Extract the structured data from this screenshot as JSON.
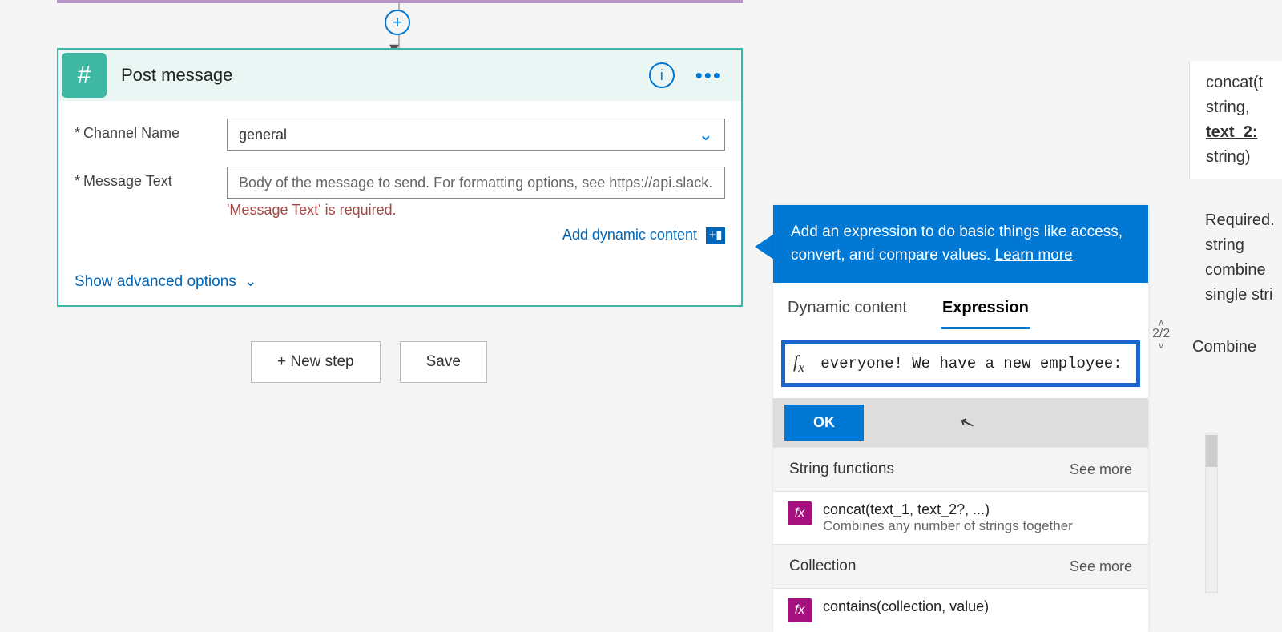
{
  "action": {
    "title": "Post message",
    "fields": {
      "channel": {
        "label": "Channel Name",
        "value": "general"
      },
      "message": {
        "label": "Message Text",
        "placeholder": "Body of the message to send. For formatting options, see https://api.slack.com",
        "error": "'Message Text' is required."
      }
    },
    "add_dynamic": "Add dynamic content",
    "show_advanced": "Show advanced options"
  },
  "buttons": {
    "new_step": "+ New step",
    "save": "Save"
  },
  "dc": {
    "header_text": "Add an expression to do basic things like access, convert, and compare values. ",
    "learn_more": "Learn more",
    "tabs": {
      "dynamic": "Dynamic content",
      "expression": "Expression"
    },
    "fx_value": "everyone! We have a new employee: ', )",
    "ok": "OK",
    "pager": "2/2",
    "sections": [
      {
        "title": "String functions",
        "see_more": "See more",
        "items": [
          {
            "name": "concat(text_1, text_2?, ...)",
            "desc": "Combines any number of strings together"
          }
        ]
      },
      {
        "title": "Collection",
        "see_more": "See more",
        "items": [
          {
            "name": "contains(collection, value)"
          }
        ]
      }
    ]
  },
  "doc": {
    "line1": "concat(t",
    "line2": "string,",
    "line3": "text_2:",
    "line4": "string)",
    "req1": "Required.",
    "req2": "string",
    "req3": "combine",
    "req4": "single stri",
    "combine": "Combine"
  }
}
